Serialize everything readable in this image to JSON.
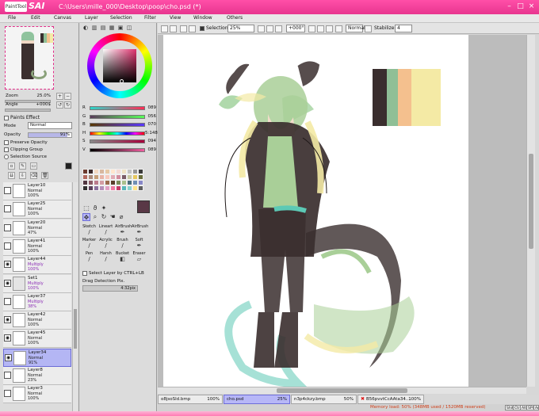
{
  "app": {
    "logo_text": "PaintTool",
    "brand": "SAI",
    "window_title": "C:\\Users\\mille_000\\Desktop\\poop\\cho.psd (*)"
  },
  "menu": [
    "File",
    "Edit",
    "Canvas",
    "Layer",
    "Selection",
    "Filter",
    "View",
    "Window",
    "Others"
  ],
  "navigator": {
    "zoom_label": "Zoom",
    "zoom_value": "25.0%",
    "angle_label": "Angle",
    "angle_value": "+000$",
    "swatch_colors": [
      "#3a2e2e",
      "#8fbf96",
      "#f4c08e",
      "#f4eaa5"
    ]
  },
  "effects": {
    "header": "Paints Effect",
    "mode_label": "Mode",
    "mode_value": "Normal",
    "opacity_label": "Opacity",
    "opacity_value": "91%",
    "preserve_opacity": "Preserve Opacity",
    "clipping_group": "Clipping Group",
    "selection_source": "Selection Source"
  },
  "layers": [
    {
      "name": "Layer10",
      "mode": "Normal",
      "opacity": "100%",
      "visible": false,
      "selected": false
    },
    {
      "name": "Layer25",
      "mode": "Normal",
      "opacity": "100%",
      "visible": false,
      "selected": false
    },
    {
      "name": "Layer20",
      "mode": "Normal",
      "opacity": "47%",
      "visible": false,
      "selected": false
    },
    {
      "name": "Layer41",
      "mode": "Normal",
      "opacity": "100%",
      "visible": false,
      "selected": false
    },
    {
      "name": "Layer44",
      "mode": "Multiply",
      "opacity": "100%",
      "visible": true,
      "selected": false
    },
    {
      "name": "Set1",
      "mode": "Multiply",
      "opacity": "100%",
      "visible": true,
      "selected": false,
      "folder": true
    },
    {
      "name": "Layer37",
      "mode": "Multiply",
      "opacity": "38%",
      "visible": false,
      "selected": false
    },
    {
      "name": "Layer42",
      "mode": "Normal",
      "opacity": "100%",
      "visible": true,
      "selected": false
    },
    {
      "name": "Layer45",
      "mode": "Normal",
      "opacity": "100%",
      "visible": true,
      "selected": false
    },
    {
      "name": "Layer34",
      "mode": "Normal",
      "opacity": "91%",
      "visible": true,
      "selected": true
    },
    {
      "name": "Layer8",
      "mode": "Normal",
      "opacity": "23%",
      "visible": false,
      "selected": false
    },
    {
      "name": "Layer3",
      "mode": "Normal",
      "opacity": "100%",
      "visible": false,
      "selected": false
    }
  ],
  "color": {
    "sliders": [
      {
        "label": "R",
        "value": "089",
        "colors": [
          "#2bd6c9",
          "#ff2b54"
        ]
      },
      {
        "label": "G",
        "value": "056",
        "colors": [
          "#5a3a5a",
          "#59ff5a"
        ]
      },
      {
        "label": "B",
        "value": "070",
        "colors": [
          "#593800",
          "#5938ff"
        ]
      },
      {
        "label": "H",
        "value": "5:148",
        "colors": [
          "#ff0000",
          "#ffff00",
          "#00ff00",
          "#00ffff",
          "#0000ff",
          "#ff00ff",
          "#ff0000"
        ]
      },
      {
        "label": "S",
        "value": "094",
        "colors": [
          "#888888",
          "#a8003b"
        ]
      },
      {
        "label": "V",
        "value": "089",
        "colors": [
          "#000000",
          "#f25ea0"
        ]
      }
    ],
    "current": "#593846",
    "secondary": "#c2b69a",
    "swatches": [
      "#6b3b2e",
      "#3b2a2a",
      "#f3d9c2",
      "#d8b8a0",
      "#e6c8a5",
      "#ffe6cf",
      "#f4d9d4",
      "#efe2c4",
      "#c3c3c3",
      "#959595",
      "#3a3a3a",
      "#b36a5e",
      "#ad8d7d",
      "#c7a07a",
      "#e8b4a7",
      "#f7c9bd",
      "#e1aab4",
      "#d28c9d",
      "#7b5c68",
      "#c9c9a2",
      "#e7c95f",
      "#6a6e3c",
      "#503640",
      "#8a5a66",
      "#bb7b8c",
      "#d49da4",
      "#9c6b4e",
      "#5a3d2a",
      "#7a8a5a",
      "#a9c08d",
      "#4a6d7c",
      "#6f8fb4",
      "#8888c8",
      "#303030",
      "#59405a",
      "#8a6f9c",
      "#b58fb8",
      "#e2a1c4",
      "#f07aa3",
      "#c53a66",
      "#58b7b9",
      "#89d3cf",
      "#ffe48a",
      "#5e5e5e"
    ]
  },
  "tools": {
    "brushes": [
      "Sketch",
      "Lineart",
      "AirBrush",
      "AirBrush",
      "Marker",
      "Acrylic",
      "Brush",
      "Soft",
      "Pen",
      "Harsh",
      "Bucket",
      "Eraser"
    ],
    "select_layer_label": "Select Layer by CTRL+LB",
    "drag_label": "Drag Detection Pix.",
    "drag_value": "4:32pix"
  },
  "canvas_toolbar": {
    "selection_label": "Selection",
    "zoom": "25%",
    "angle": "+000°",
    "blend": "Normal",
    "stabilizer_label": "Stabilizer",
    "stabilizer_value": "4"
  },
  "canvas": {
    "palette": [
      "#3a2e2e",
      "#8fbf96",
      "#f4c08e",
      "#f4eaa5"
    ]
  },
  "tabs": [
    {
      "name": "o8jsoSld.bmp",
      "pct": "100%",
      "active": false
    },
    {
      "name": "cho.psd",
      "pct": "25%",
      "active": true
    },
    {
      "name": "n3p4ckzy.bmp",
      "pct": "50%",
      "active": false
    },
    {
      "name": "B56pvvtCcAAta34....",
      "pct": "100%",
      "active": false
    }
  ],
  "status": {
    "memory": "Memory load: 50% (348MB used / 1520MB reserved)",
    "keys": [
      "Shift",
      "Ctrl",
      "Alt",
      "SPC",
      "Any"
    ]
  },
  "window_buttons": [
    "–",
    "□",
    "×"
  ]
}
